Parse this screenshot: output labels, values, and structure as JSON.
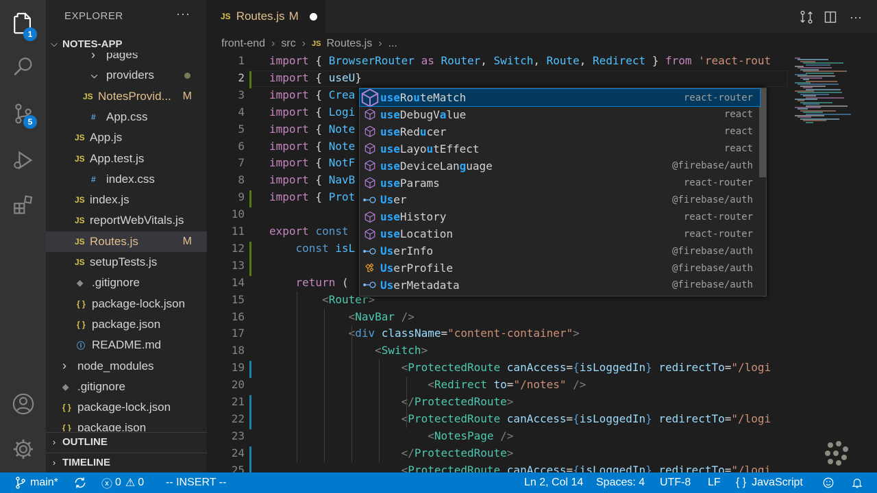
{
  "activity": {
    "explorer_badge": "1",
    "scm_badge": "5"
  },
  "sidebar": {
    "title": "EXPLORER",
    "more": "···",
    "project": "NOTES-APP",
    "items": [
      {
        "label": "pages",
        "icon": "chevron",
        "indent": 2
      },
      {
        "label": "providers",
        "icon": "chevron-down",
        "indent": 2,
        "mod_dot": true
      },
      {
        "label": "NotesProvid...",
        "icon": "JS",
        "indent": 3,
        "git": "M"
      },
      {
        "label": "App.css",
        "icon": "#",
        "indent": 2
      },
      {
        "label": "App.js",
        "icon": "JS",
        "indent": 2
      },
      {
        "label": "App.test.js",
        "icon": "JS",
        "indent": 2
      },
      {
        "label": "index.css",
        "icon": "#",
        "indent": 2
      },
      {
        "label": "index.js",
        "icon": "JS",
        "indent": 2
      },
      {
        "label": "reportWebVitals.js",
        "icon": "JS",
        "indent": 2
      },
      {
        "label": "Routes.js",
        "icon": "JS",
        "indent": 2,
        "git": "M",
        "selected": true
      },
      {
        "label": "setupTests.js",
        "icon": "JS",
        "indent": 2
      },
      {
        "label": ".gitignore",
        "icon": "git",
        "indent": 1
      },
      {
        "label": "package-lock.json",
        "icon": "{}",
        "indent": 1
      },
      {
        "label": "package.json",
        "icon": "{}",
        "indent": 1
      },
      {
        "label": "README.md",
        "icon": "info",
        "indent": 1
      },
      {
        "label": "node_modules",
        "icon": "chevron",
        "indent": 0
      },
      {
        "label": ".gitignore",
        "icon": "git",
        "indent": 0
      },
      {
        "label": "package-lock.json",
        "icon": "{}",
        "indent": 0
      },
      {
        "label": "package.json",
        "icon": "{}",
        "indent": 0
      }
    ],
    "outline": "OUTLINE",
    "timeline": "TIMELINE"
  },
  "tab": {
    "icon": "JS",
    "name": "Routes.js",
    "modified": "M"
  },
  "breadcrumb": {
    "parts": [
      "front-end",
      "src",
      "Routes.js",
      "..."
    ]
  },
  "editor": {
    "lines": [
      {
        "n": "1",
        "html": "<span class='kw'>import</span> { <span class='vr'>BrowserRouter</span> <span class='kw'>as</span> <span class='vr'>Router</span>, <span class='vr'>Switch</span>, <span class='vr'>Route</span>, <span class='vr'>Redirect</span> } <span class='kw'>from</span> <span class='st'>'react-rout</span>"
      },
      {
        "n": "2",
        "html": "<span class='kw'>import</span> { <span class='id'>useU</span>}"
      },
      {
        "n": "3",
        "html": "<span class='kw'>import</span> { <span class='vr'>Crea</span>"
      },
      {
        "n": "4",
        "html": "<span class='kw'>import</span> { <span class='vr'>Logi</span>"
      },
      {
        "n": "5",
        "html": "<span class='kw'>import</span> { <span class='vr'>Note</span>"
      },
      {
        "n": "6",
        "html": "<span class='kw'>import</span> { <span class='vr'>Note</span>"
      },
      {
        "n": "7",
        "html": "<span class='kw'>import</span> { <span class='vr'>NotF</span>"
      },
      {
        "n": "8",
        "html": "<span class='kw'>import</span> { <span class='vr'>NavB</span>"
      },
      {
        "n": "9",
        "html": "<span class='kw'>import</span> { <span class='vr'>Prot</span>"
      },
      {
        "n": "10",
        "html": ""
      },
      {
        "n": "11",
        "html": "<span class='kw'>export</span> <span class='kb'>const</span> "
      },
      {
        "n": "12",
        "html": "    <span class='kb'>const</span> <span class='vr'>isL</span>"
      },
      {
        "n": "13",
        "html": ""
      },
      {
        "n": "14",
        "html": "    <span class='kw'>return</span> ("
      },
      {
        "n": "15",
        "html": "        <span class='pu'>&lt;</span><span class='tg'>Router</span><span class='pu'>&gt;</span>"
      },
      {
        "n": "16",
        "html": "            <span class='pu'>&lt;</span><span class='tg'>NavBar</span> <span class='pu'>/&gt;</span>"
      },
      {
        "n": "17",
        "html": "            <span class='pu'>&lt;</span><span class='kb'>div</span> <span class='id'>className</span>=<span class='st'>\"content-container\"</span><span class='pu'>&gt;</span>"
      },
      {
        "n": "18",
        "html": "                <span class='pu'>&lt;</span><span class='tg'>Switch</span><span class='pu'>&gt;</span>"
      },
      {
        "n": "19",
        "html": "                    <span class='pu'>&lt;</span><span class='tg'>ProtectedRoute</span> <span class='id'>canAccess</span>=<span class='kb'>{</span><span class='id'>isLoggedIn</span><span class='kb'>}</span> <span class='id'>redirectTo</span>=<span class='st'>\"/logi</span>"
      },
      {
        "n": "20",
        "html": "                        <span class='pu'>&lt;</span><span class='tg'>Redirect</span> <span class='id'>to</span>=<span class='st'>\"/notes\"</span> <span class='pu'>/&gt;</span>"
      },
      {
        "n": "21",
        "html": "                    <span class='pu'>&lt;/</span><span class='tg'>ProtectedRoute</span><span class='pu'>&gt;</span>"
      },
      {
        "n": "22",
        "html": "                    <span class='pu'>&lt;</span><span class='tg'>ProtectedRoute</span> <span class='id'>canAccess</span>=<span class='kb'>{</span><span class='id'>isLoggedIn</span><span class='kb'>}</span> <span class='id'>redirectTo</span>=<span class='st'>\"/logi</span>"
      },
      {
        "n": "23",
        "html": "                        <span class='pu'>&lt;</span><span class='tg'>NotesPage</span> <span class='pu'>/&gt;</span>"
      },
      {
        "n": "24",
        "html": "                    <span class='pu'>&lt;/</span><span class='tg'>ProtectedRoute</span><span class='pu'>&gt;</span>"
      },
      {
        "n": "25",
        "html": "                    <span class='pu'>&lt;</span><span class='tg'>ProtectedRoute</span> <span class='id'>canAccess</span>=<span class='kb'>{</span><span class='id'>isLoggedIn</span><span class='kb'>}</span> <span class='id'>redirectTo</span>=<span class='st'>\"/logi</span>"
      }
    ]
  },
  "suggest": {
    "items": [
      {
        "pre": "use",
        "mid": "Ro",
        "b2": "u",
        "post": "teMatch",
        "plain": "useRouteMatch",
        "src": "react-router",
        "kind": "cube",
        "match": [
          0,
          1,
          2,
          5
        ]
      },
      {
        "plain": "useDebugValue",
        "src": "react",
        "kind": "cube",
        "match": [
          0,
          1,
          2,
          9
        ]
      },
      {
        "plain": "useReducer",
        "src": "react",
        "kind": "cube",
        "match": [
          0,
          1,
          2,
          6
        ]
      },
      {
        "plain": "useLayoutEffect",
        "src": "react",
        "kind": "cube",
        "match": [
          0,
          1,
          2,
          7
        ]
      },
      {
        "plain": "useDeviceLanguage",
        "src": "@firebase/auth",
        "kind": "cube",
        "match": [
          0,
          1,
          2,
          12
        ]
      },
      {
        "plain": "useParams",
        "src": "react-router",
        "kind": "cube",
        "match": [
          0,
          1,
          2
        ]
      },
      {
        "plain": "User",
        "src": "@firebase/auth",
        "kind": "iface",
        "match": [
          0,
          1
        ]
      },
      {
        "plain": "useHistory",
        "src": "react-router",
        "kind": "cube",
        "match": [
          0,
          1,
          2
        ]
      },
      {
        "plain": "useLocation",
        "src": "react-router",
        "kind": "cube",
        "match": [
          0,
          1,
          2
        ]
      },
      {
        "plain": "UserInfo",
        "src": "@firebase/auth",
        "kind": "iface",
        "match": [
          0,
          1
        ]
      },
      {
        "plain": "UserProfile",
        "src": "@firebase/auth",
        "kind": "class",
        "match": [
          0,
          1
        ]
      },
      {
        "plain": "UserMetadata",
        "src": "@firebase/auth",
        "kind": "iface",
        "match": [
          0,
          1
        ]
      }
    ]
  },
  "status": {
    "branch": "main*",
    "errors": "0",
    "warnings": "0",
    "mode": "-- INSERT --",
    "position": "Ln 2, Col 14",
    "spaces": "Spaces: 4",
    "encoding": "UTF-8",
    "eol": "LF",
    "braces": "{ }",
    "language": "JavaScript"
  }
}
